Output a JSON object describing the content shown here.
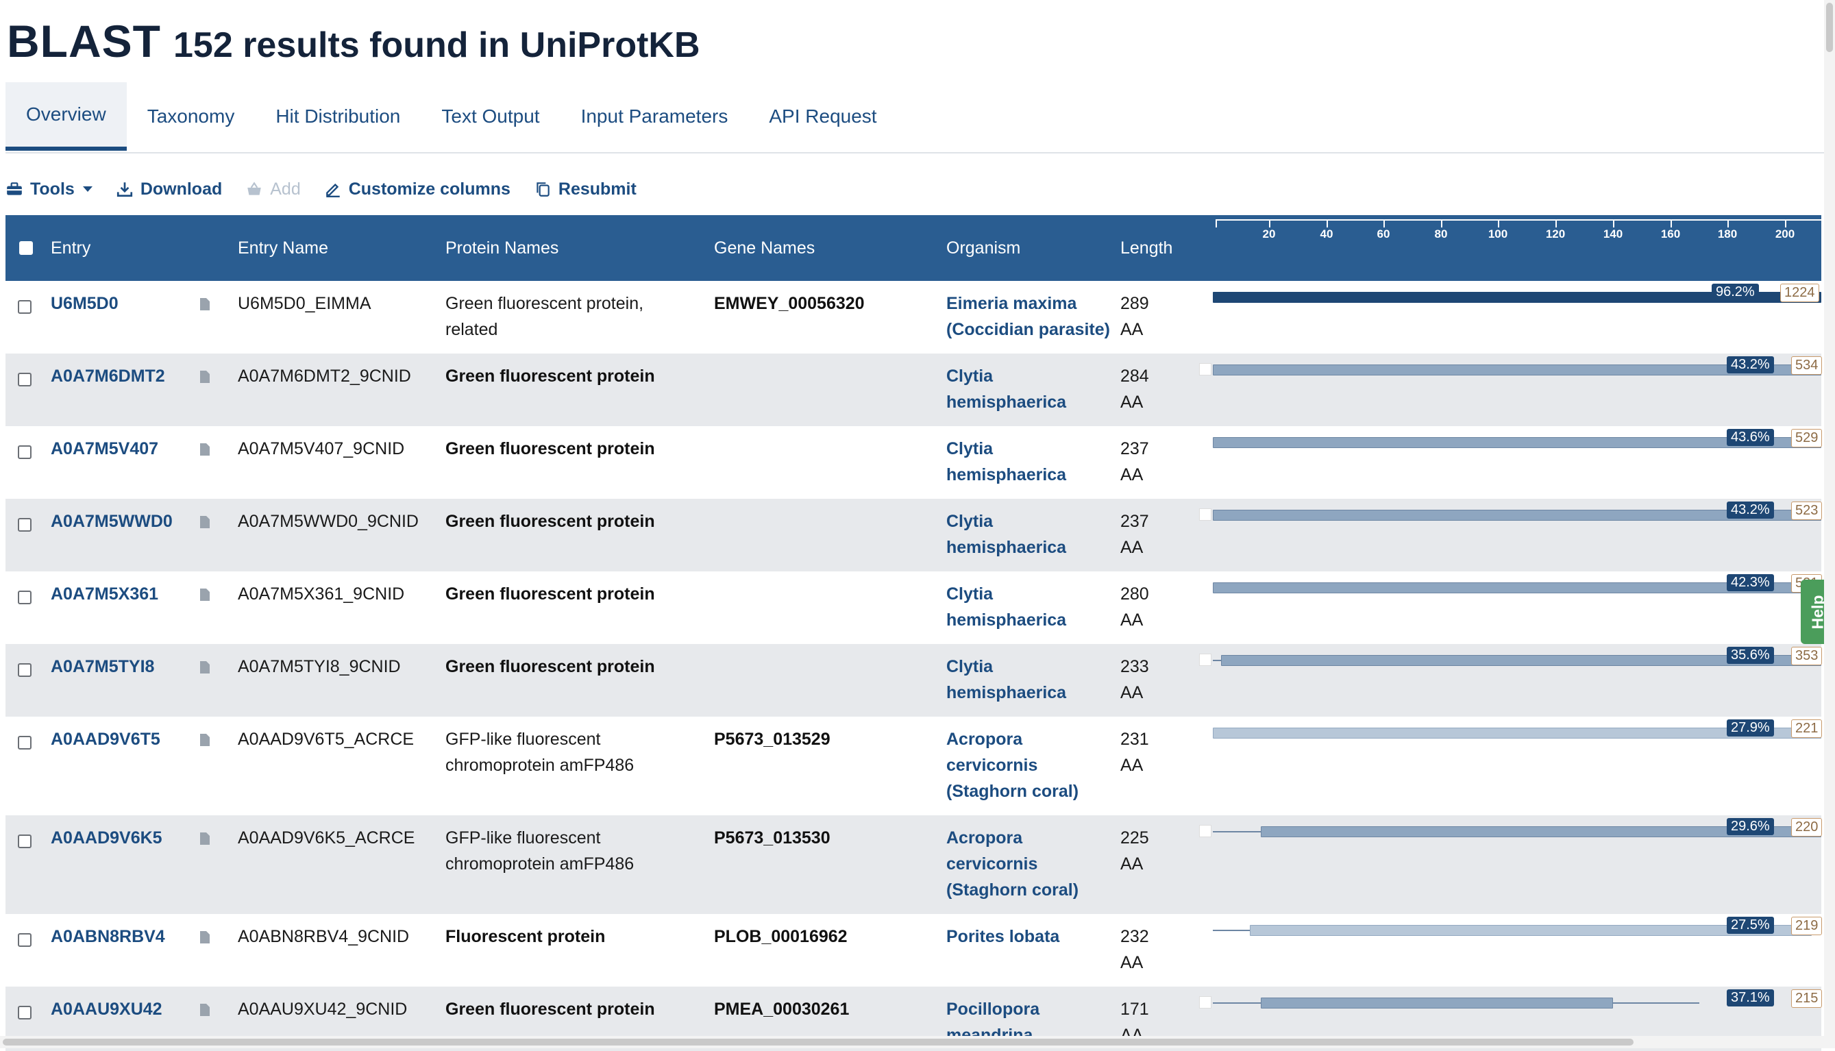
{
  "title": {
    "main": "BLAST",
    "sub": "152 results found in UniProtKB"
  },
  "tabs": [
    "Overview",
    "Taxonomy",
    "Hit Distribution",
    "Text Output",
    "Input Parameters",
    "API Request"
  ],
  "toolbar": {
    "tools": "Tools",
    "download": "Download",
    "add": "Add",
    "customize": "Customize columns",
    "resubmit": "Resubmit"
  },
  "columns": {
    "entry": "Entry",
    "entry_name": "Entry Name",
    "protein_names": "Protein Names",
    "gene_names": "Gene Names",
    "organism": "Organism",
    "length": "Length"
  },
  "axis_ticks": [
    "20",
    "40",
    "60",
    "80",
    "100",
    "120",
    "140",
    "160",
    "180",
    "200"
  ],
  "rows": [
    {
      "entry": "U6M5D0",
      "entry_name": "U6M5D0_EIMMA",
      "protein1": "Green fluorescent protein,",
      "protein2": "related",
      "gene": "EMWEY_00056320",
      "org1": "Eimeria maxima",
      "org2": "(Coccidian parasite)",
      "org3": "",
      "len": "289",
      "len_unit": "AA",
      "identity": "96.2%",
      "score": "1224"
    },
    {
      "entry": "A0A7M6DMT2",
      "entry_name": "A0A7M6DMT2_9CNID",
      "protein1": "Green fluorescent protein",
      "protein2": "",
      "gene": "",
      "org1": "Clytia",
      "org2": "hemisphaerica",
      "org3": "",
      "len": "284",
      "len_unit": "AA",
      "identity": "43.2%",
      "score": "534"
    },
    {
      "entry": "A0A7M5V407",
      "entry_name": "A0A7M5V407_9CNID",
      "protein1": "Green fluorescent protein",
      "protein2": "",
      "gene": "",
      "org1": "Clytia",
      "org2": "hemisphaerica",
      "org3": "",
      "len": "237",
      "len_unit": "AA",
      "identity": "43.6%",
      "score": "529"
    },
    {
      "entry": "A0A7M5WWD0",
      "entry_name": "A0A7M5WWD0_9CNID",
      "protein1": "Green fluorescent protein",
      "protein2": "",
      "gene": "",
      "org1": "Clytia",
      "org2": "hemisphaerica",
      "org3": "",
      "len": "237",
      "len_unit": "AA",
      "identity": "43.2%",
      "score": "523"
    },
    {
      "entry": "A0A7M5X361",
      "entry_name": "A0A7M5X361_9CNID",
      "protein1": "Green fluorescent protein",
      "protein2": "",
      "gene": "",
      "org1": "Clytia",
      "org2": "hemisphaerica",
      "org3": "",
      "len": "280",
      "len_unit": "AA",
      "identity": "42.3%",
      "score": "521"
    },
    {
      "entry": "A0A7M5TYI8",
      "entry_name": "A0A7M5TYI8_9CNID",
      "protein1": "Green fluorescent protein",
      "protein2": "",
      "gene": "",
      "org1": "Clytia",
      "org2": "hemisphaerica",
      "org3": "",
      "len": "233",
      "len_unit": "AA",
      "identity": "35.6%",
      "score": "353"
    },
    {
      "entry": "A0AAD9V6T5",
      "entry_name": "A0AAD9V6T5_ACRCE",
      "protein1": "GFP-like fluorescent",
      "protein2": "chromoprotein amFP486",
      "gene": "P5673_013529",
      "org1": "Acropora",
      "org2": "cervicornis",
      "org3": "(Staghorn coral)",
      "len": "231",
      "len_unit": "AA",
      "identity": "27.9%",
      "score": "221"
    },
    {
      "entry": "A0AAD9V6K5",
      "entry_name": "A0AAD9V6K5_ACRCE",
      "protein1": "GFP-like fluorescent",
      "protein2": "chromoprotein amFP486",
      "gene": "P5673_013530",
      "org1": "Acropora",
      "org2": "cervicornis",
      "org3": "(Staghorn coral)",
      "len": "225",
      "len_unit": "AA",
      "identity": "29.6%",
      "score": "220"
    },
    {
      "entry": "A0ABN8RBV4",
      "entry_name": "A0ABN8RBV4_9CNID",
      "protein1": "Fluorescent protein",
      "protein2": "",
      "gene": "PLOB_00016962",
      "org1": "Porites lobata",
      "org2": "",
      "org3": "",
      "len": "232",
      "len_unit": "AA",
      "identity": "27.5%",
      "score": "219"
    },
    {
      "entry": "A0AAU9XU42",
      "entry_name": "A0AAU9XU42_9CNID",
      "protein1": "Green fluorescent protein",
      "protein2": "",
      "gene": "PMEA_00030261",
      "org1": "Pocillopora",
      "org2": "meandrina",
      "org3": "",
      "len": "171",
      "len_unit": "AA",
      "identity": "37.1%",
      "score": "215"
    }
  ],
  "help": "Help"
}
